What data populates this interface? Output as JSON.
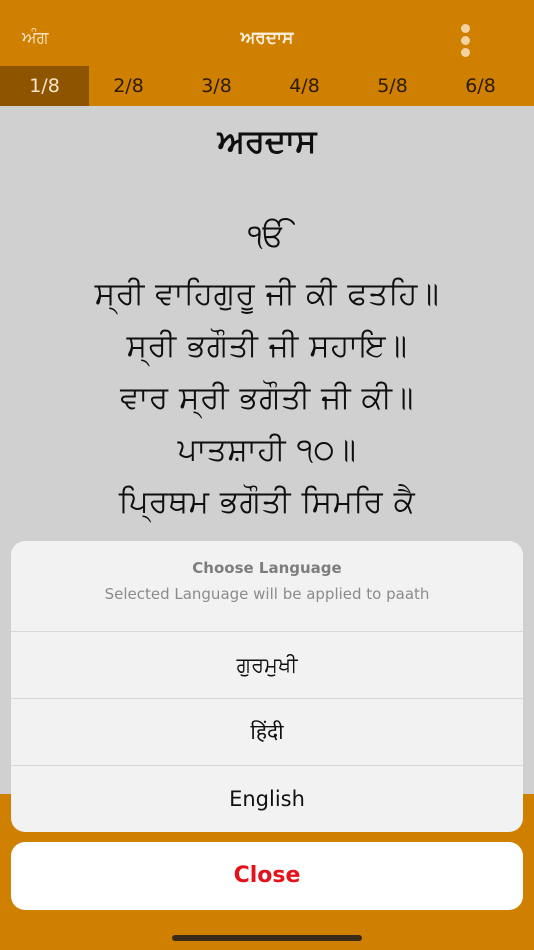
{
  "header": {
    "left_label": "ਅੰਗ",
    "title": "ਅਰਦਾਸ"
  },
  "tabs": [
    {
      "label": "1/8",
      "active": true
    },
    {
      "label": "2/8",
      "active": false
    },
    {
      "label": "3/8",
      "active": false
    },
    {
      "label": "4/8",
      "active": false
    },
    {
      "label": "5/8",
      "active": false
    },
    {
      "label": "6/8",
      "active": false
    }
  ],
  "content": {
    "title": "ਅਰਦਾਸ",
    "lines": [
      "ੴ",
      "ਸ੍ਰੀ ਵਾਹਿਗੁਰੂ ਜੀ ਕੀ ਫਤਹਿ॥",
      "ਸ੍ਰੀ ਭਗੌਤੀ ਜੀ ਸਹਾਇ॥",
      "ਵਾਰ ਸ੍ਰੀ ਭਗੌਤੀ ਜੀ ਕੀ॥",
      "ਪਾਤਸ਼ਾਹੀ ੧੦॥",
      "ਪ੍ਰਿਥਮ ਭਗੌਤੀ ਸਿਮਰਿ ਕੈ"
    ]
  },
  "sheet": {
    "title": "Choose Language",
    "subtitle": "Selected Language will be applied to paath",
    "options": [
      "ਗੁਰਮੁਖੀ",
      "हिंदी",
      "English"
    ],
    "close_label": "Close"
  },
  "colors": {
    "accent": "#d08000",
    "active_tab": "#8e5400",
    "close": "#e3121b"
  }
}
